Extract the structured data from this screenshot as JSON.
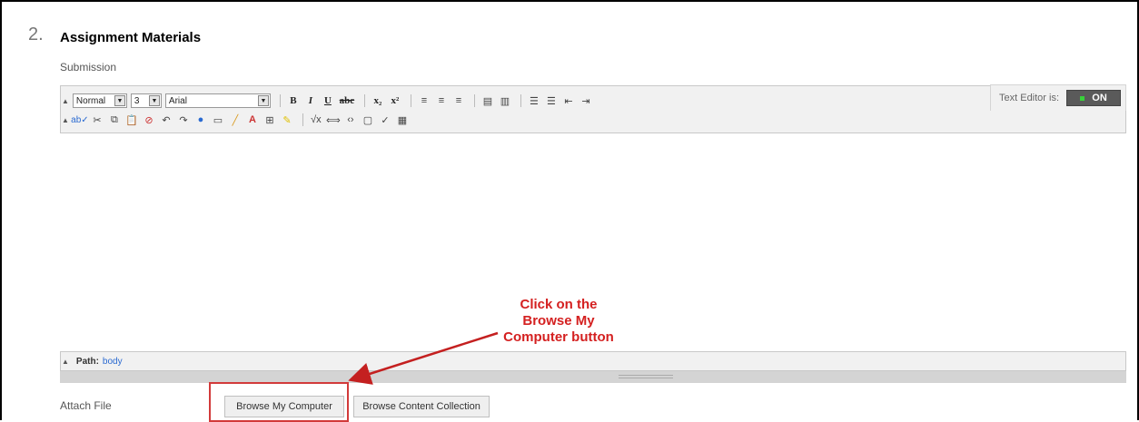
{
  "section": {
    "number": "2.",
    "title": "Assignment Materials"
  },
  "submission": {
    "label": "Submission"
  },
  "text_editor_toggle": {
    "label": "Text Editor is:",
    "state": "ON"
  },
  "toolbar": {
    "format_select": "Normal",
    "size_select": "3",
    "font_select": "Arial",
    "row1_icons": [
      "bold-icon",
      "italic-icon",
      "underline-icon",
      "strikethrough-icon",
      "subscript-icon",
      "superscript-icon",
      "align-left-icon",
      "align-center-icon",
      "align-right-icon",
      "paste-icon",
      "copy-icon",
      "ordered-list-icon",
      "unordered-list-icon",
      "outdent-icon",
      "indent-icon"
    ],
    "row2_icons": [
      "spellcheck-icon",
      "cut-icon",
      "copy-icon",
      "paste-icon",
      "unlink-icon",
      "undo-icon",
      "redo-icon",
      "link-icon",
      "table-icon",
      "pen-icon",
      "text-color-icon",
      "insert-icon",
      "highlight-icon",
      "math-icon",
      "embed-icon",
      "html-icon",
      "fullscreen-icon",
      "check-icon",
      "preview-icon"
    ]
  },
  "path_bar": {
    "label": "Path:",
    "value": "body"
  },
  "attach": {
    "label": "Attach File",
    "browse_computer": "Browse My Computer",
    "browse_content": "Browse Content Collection"
  },
  "annotation": {
    "line1": "Click on the",
    "line2": "Browse My",
    "line3": "Computer button",
    "color": "#d42020"
  }
}
